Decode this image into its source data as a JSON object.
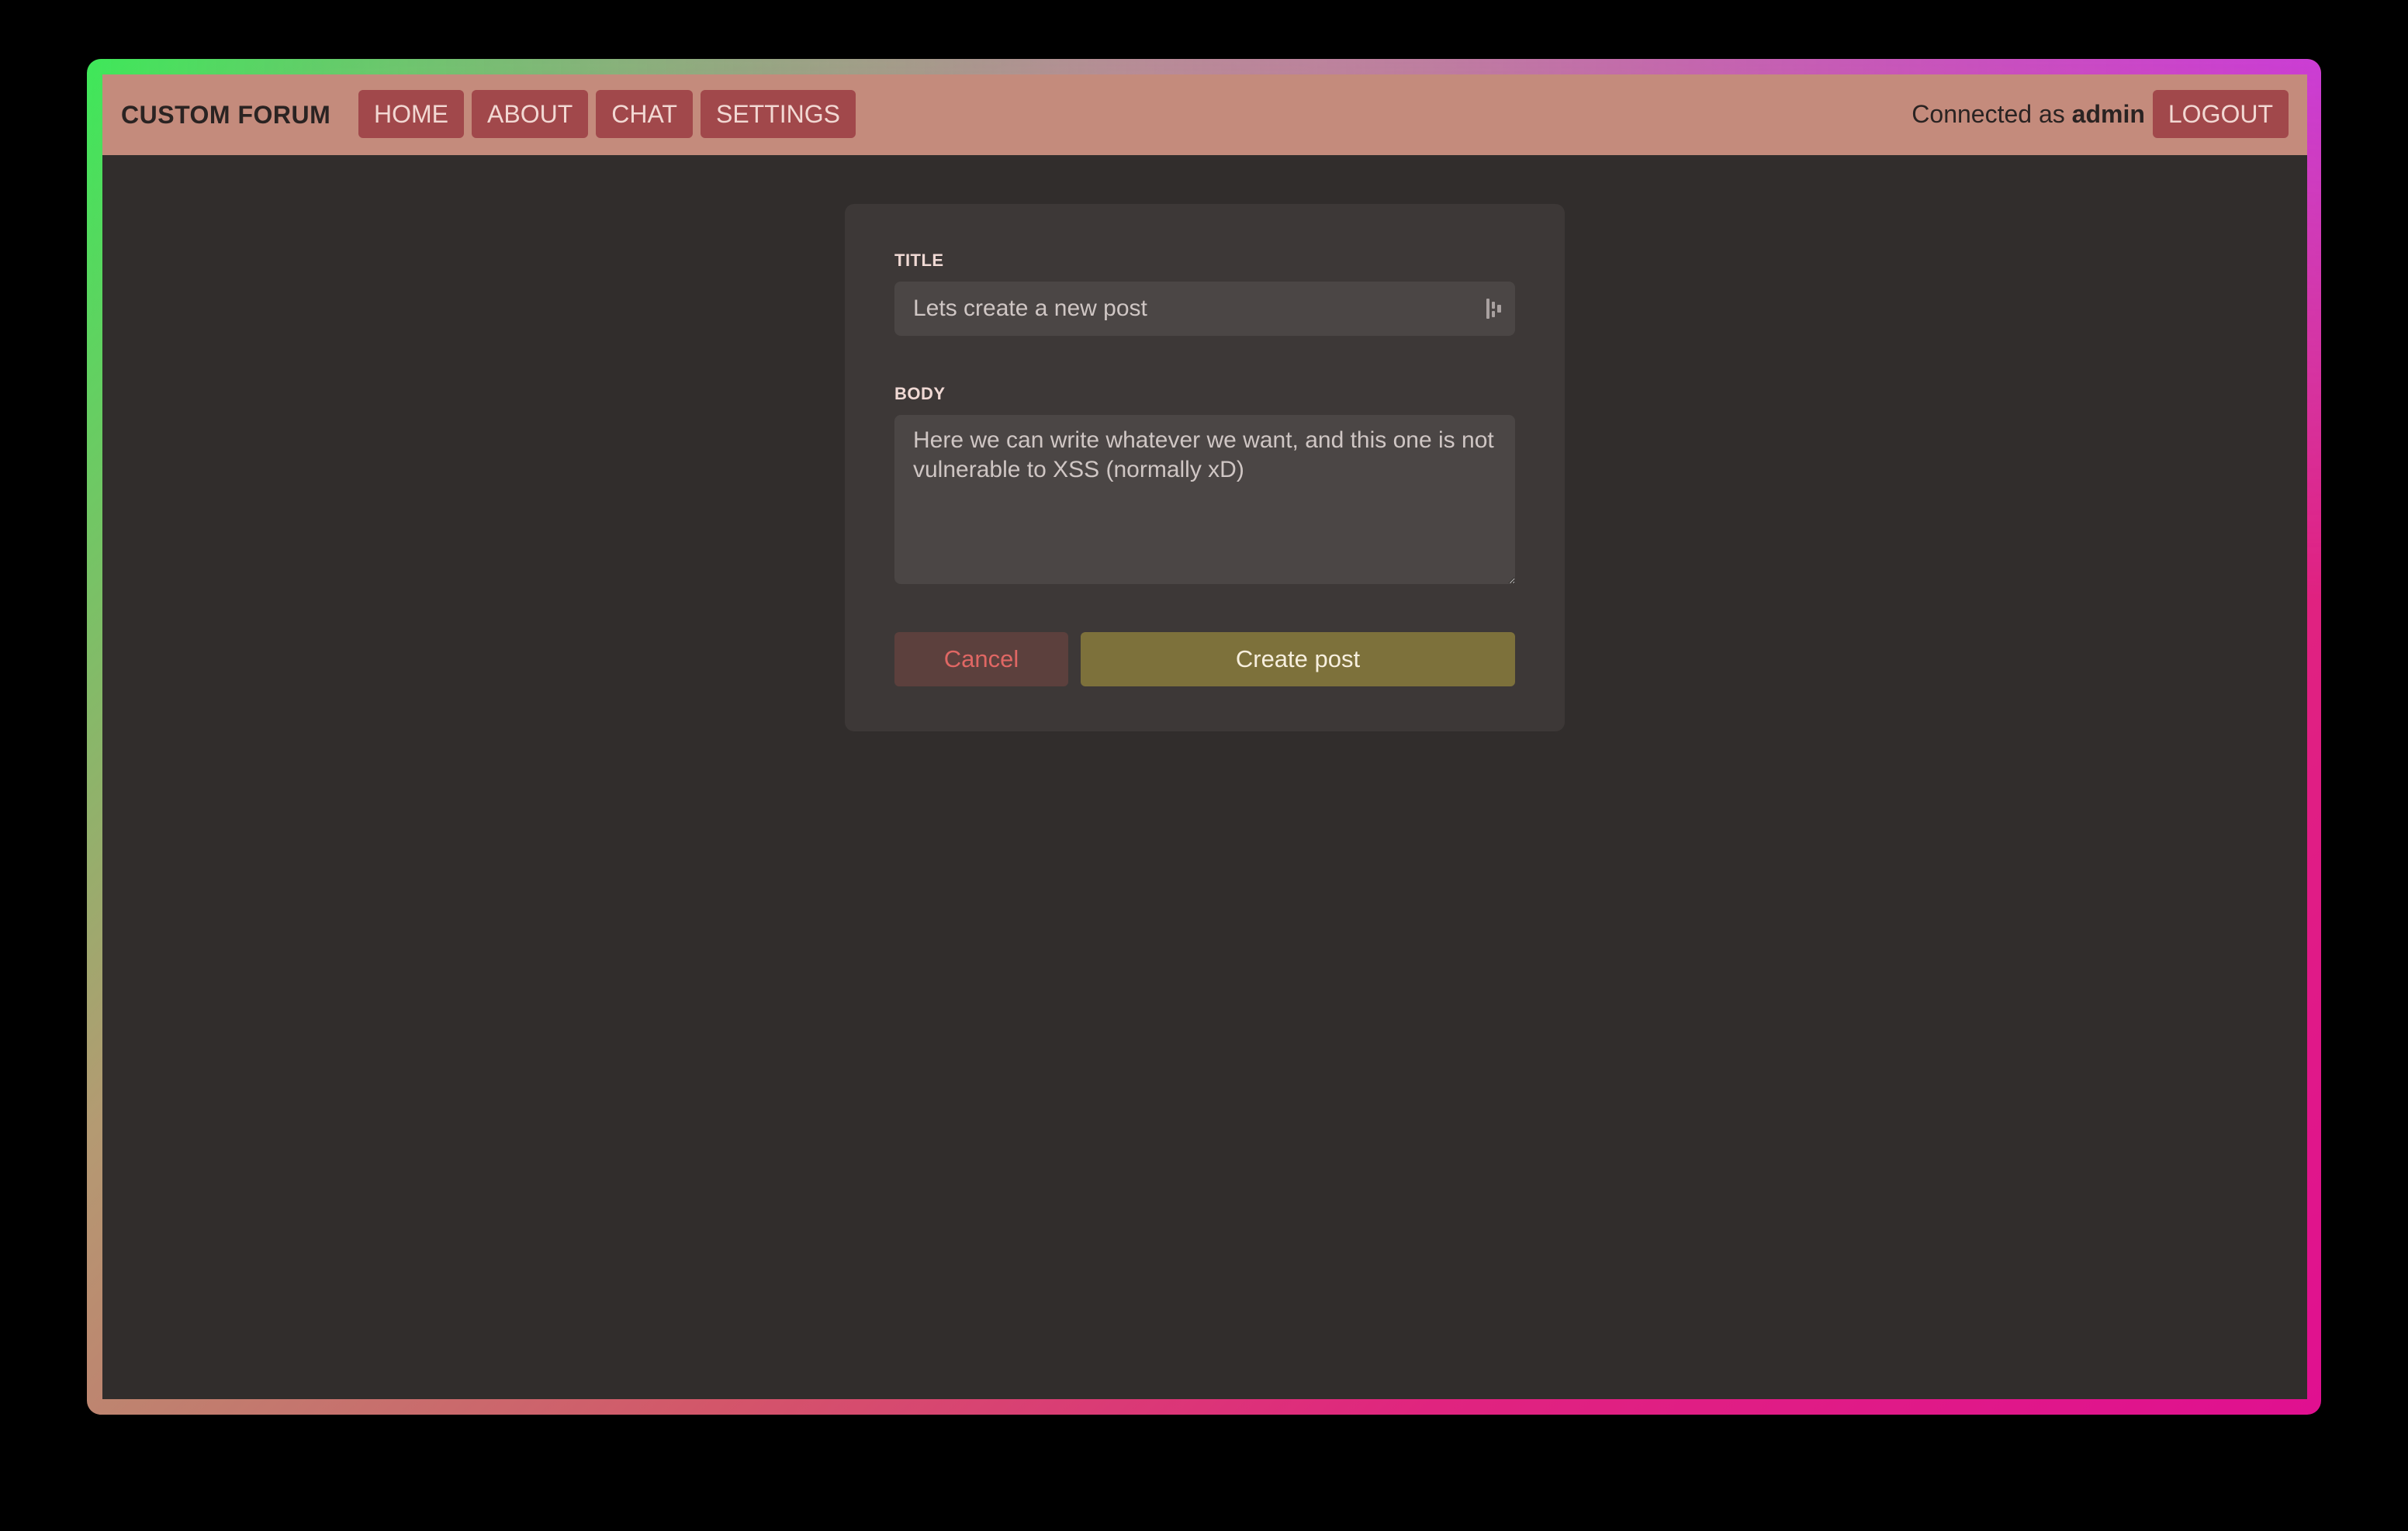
{
  "app": {
    "brand": "CUSTOM FORUM"
  },
  "nav": {
    "items": [
      {
        "label": "HOME"
      },
      {
        "label": "ABOUT"
      },
      {
        "label": "CHAT"
      },
      {
        "label": "SETTINGS"
      }
    ],
    "connected_prefix": "Connected as",
    "username": "admin",
    "logout_label": "LOGOUT"
  },
  "form": {
    "title_label": "TITLE",
    "title_value": "Lets create a new post",
    "body_label": "BODY",
    "body_value": "Here we can write whatever we want, and this one is not vulnerable to XSS (normally xD)",
    "cancel_label": "Cancel",
    "create_label": "Create post"
  },
  "colors": {
    "navbar": "#c48b7c",
    "nav_button": "#a1484b",
    "page_bg": "#312d2c",
    "card_bg": "#3d3837",
    "input_bg": "#4b4645",
    "cancel_bg": "#5c403d",
    "cancel_text": "#e06764",
    "create_bg": "#7d713b"
  },
  "icons": {
    "title_field_icon": "password-manager-icon"
  }
}
